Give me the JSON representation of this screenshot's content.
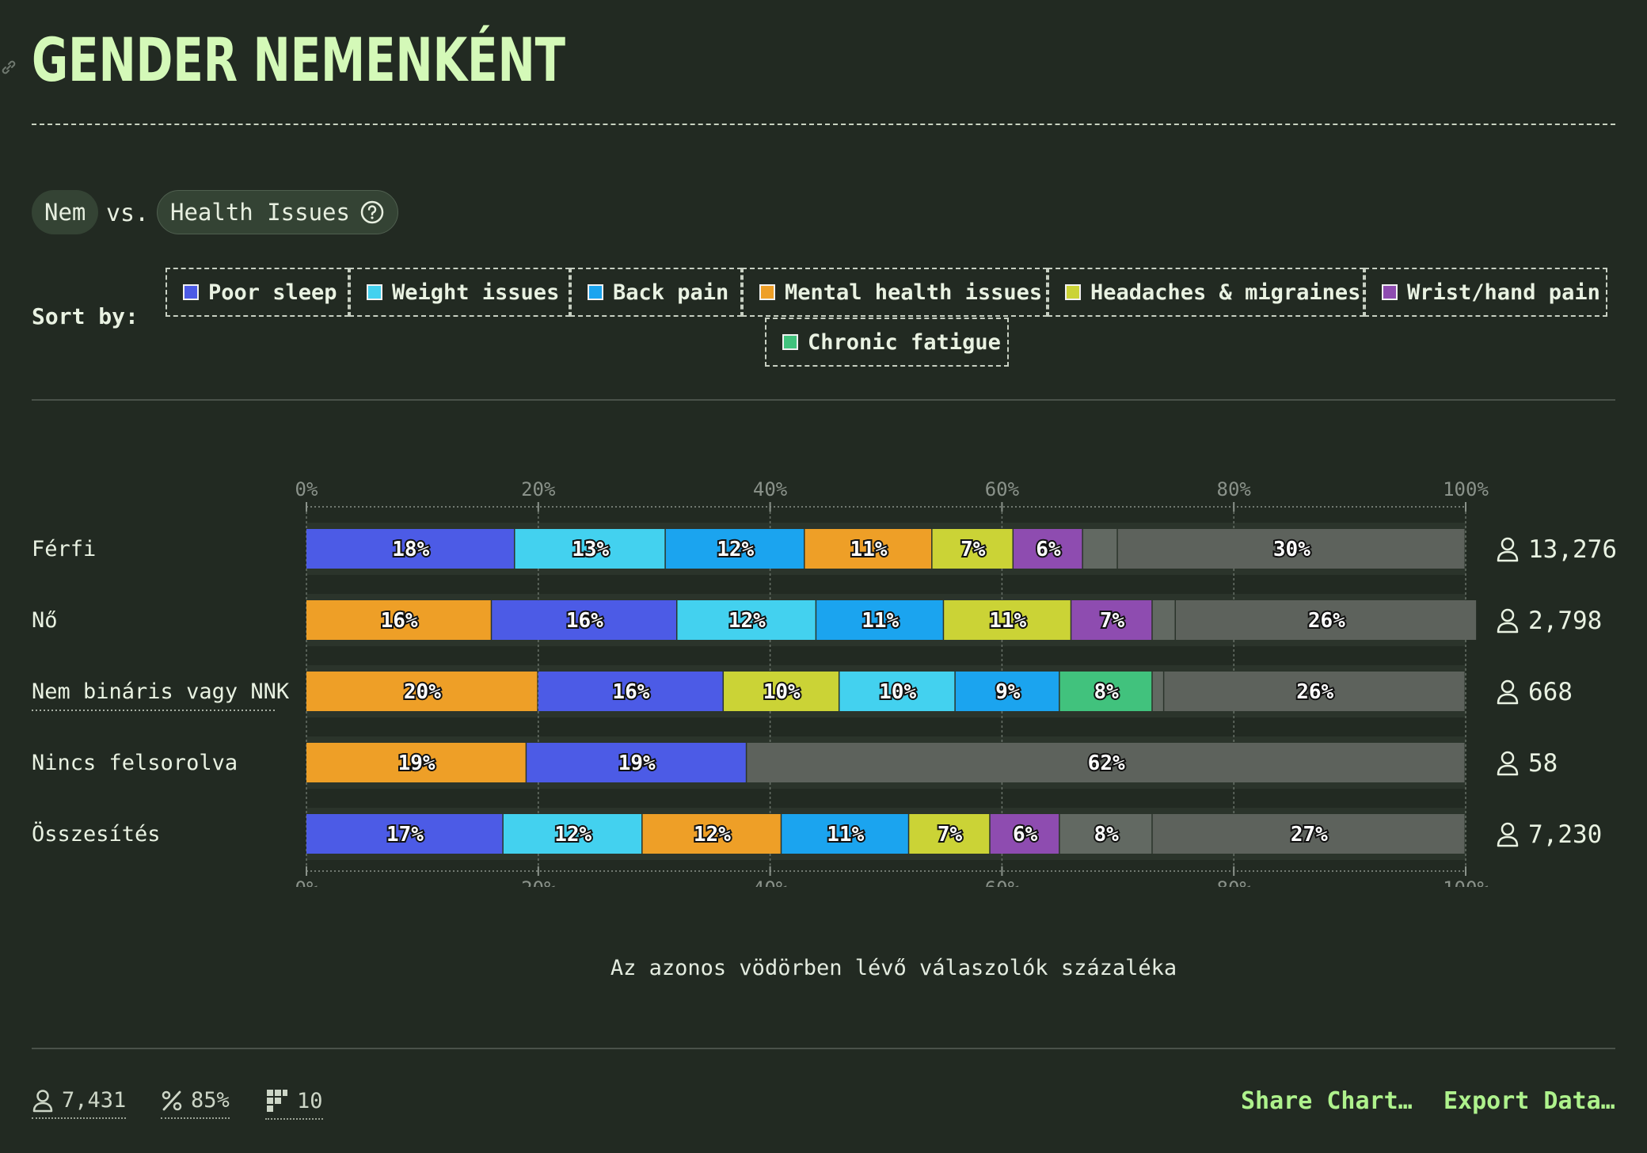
{
  "title": "GENDER NEMENKÉNT",
  "compare": {
    "left": "Nem",
    "vs": "vs.",
    "right": "Health Issues"
  },
  "sort": {
    "label": "Sort by:",
    "options": [
      {
        "label": "Poor sleep",
        "color": "#4c5be6"
      },
      {
        "label": "Weight issues",
        "color": "#43d1ef"
      },
      {
        "label": "Back pain",
        "color": "#1ba4ef"
      },
      {
        "label": "Mental health issues",
        "color": "#ee9f27"
      },
      {
        "label": "Headaches & migraines",
        "color": "#cbd336"
      },
      {
        "label": "Wrist/hand pain",
        "color": "#8e4cb0"
      },
      {
        "label": "Chronic fatigue",
        "color": "#41c27d"
      }
    ]
  },
  "chart_data": {
    "type": "bar",
    "orientation": "horizontal",
    "stacked": true,
    "xlabel": "Az azonos vödörben lévő válaszolók százaléka",
    "xlim": [
      0,
      100
    ],
    "ticks": [
      "0%",
      "20%",
      "40%",
      "60%",
      "80%",
      "100%"
    ],
    "grid": true,
    "rows": [
      {
        "label": "Férfi",
        "count": "13,276",
        "segments": [
          {
            "category": "Poor sleep",
            "value": 18,
            "label": "18%"
          },
          {
            "category": "Weight issues",
            "value": 13,
            "label": "13%"
          },
          {
            "category": "Back pain",
            "value": 12,
            "label": "12%"
          },
          {
            "category": "Mental health issues",
            "value": 11,
            "label": "11%"
          },
          {
            "category": "Headaches & migraines",
            "value": 7,
            "label": "7%"
          },
          {
            "category": "Wrist/hand pain",
            "value": 6,
            "label": "6%"
          },
          {
            "category": "other",
            "value": 3,
            "label": ""
          },
          {
            "category": "none",
            "value": 30,
            "label": "30%"
          }
        ]
      },
      {
        "label": "Nő",
        "count": "2,798",
        "segments": [
          {
            "category": "Mental health issues",
            "value": 16,
            "label": "16%"
          },
          {
            "category": "Poor sleep",
            "value": 16,
            "label": "16%"
          },
          {
            "category": "Weight issues",
            "value": 12,
            "label": "12%"
          },
          {
            "category": "Back pain",
            "value": 11,
            "label": "11%"
          },
          {
            "category": "Headaches & migraines",
            "value": 11,
            "label": "11%"
          },
          {
            "category": "Wrist/hand pain",
            "value": 7,
            "label": "7%"
          },
          {
            "category": "other",
            "value": 2,
            "label": ""
          },
          {
            "category": "none",
            "value": 26,
            "label": "26%"
          }
        ]
      },
      {
        "label": "Nem bináris vagy NNK",
        "count": "668",
        "segments": [
          {
            "category": "Mental health issues",
            "value": 20,
            "label": "20%"
          },
          {
            "category": "Poor sleep",
            "value": 16,
            "label": "16%"
          },
          {
            "category": "Headaches & migraines",
            "value": 10,
            "label": "10%"
          },
          {
            "category": "Weight issues",
            "value": 10,
            "label": "10%"
          },
          {
            "category": "Back pain",
            "value": 9,
            "label": "9%"
          },
          {
            "category": "Chronic fatigue",
            "value": 8,
            "label": "8%"
          },
          {
            "category": "other",
            "value": 1,
            "label": ""
          },
          {
            "category": "none",
            "value": 26,
            "label": "26%"
          }
        ]
      },
      {
        "label": "Nincs felsorolva",
        "count": "58",
        "segments": [
          {
            "category": "Mental health issues",
            "value": 19,
            "label": "19%"
          },
          {
            "category": "Poor sleep",
            "value": 19,
            "label": "19%"
          },
          {
            "category": "none",
            "value": 62,
            "label": "62%"
          }
        ]
      },
      {
        "label": "Összesítés",
        "count": "7,230",
        "segments": [
          {
            "category": "Poor sleep",
            "value": 17,
            "label": "17%"
          },
          {
            "category": "Weight issues",
            "value": 12,
            "label": "12%"
          },
          {
            "category": "Mental health issues",
            "value": 12,
            "label": "12%"
          },
          {
            "category": "Back pain",
            "value": 11,
            "label": "11%"
          },
          {
            "category": "Headaches & migraines",
            "value": 7,
            "label": "7%"
          },
          {
            "category": "Wrist/hand pain",
            "value": 6,
            "label": "6%"
          },
          {
            "category": "other",
            "value": 8,
            "label": "8%"
          },
          {
            "category": "none",
            "value": 27,
            "label": "27%"
          }
        ]
      }
    ],
    "colors": {
      "Poor sleep": "#4c5be6",
      "Weight issues": "#43d1ef",
      "Back pain": "#1ba4ef",
      "Mental health issues": "#ee9f27",
      "Headaches & migraines": "#cbd336",
      "Wrist/hand pain": "#8e4cb0",
      "Chronic fatigue": "#41c27d",
      "other": "#626962",
      "none": "#5d625c"
    }
  },
  "footer": {
    "respondents": "7,431",
    "percent": "85%",
    "count": "10",
    "share": "Share Chart…",
    "export": "Export Data…"
  },
  "icons": {
    "user": "user-icon",
    "percent": "percent-icon",
    "grid": "grid-icon",
    "link": "link-icon",
    "help": "help-icon"
  }
}
